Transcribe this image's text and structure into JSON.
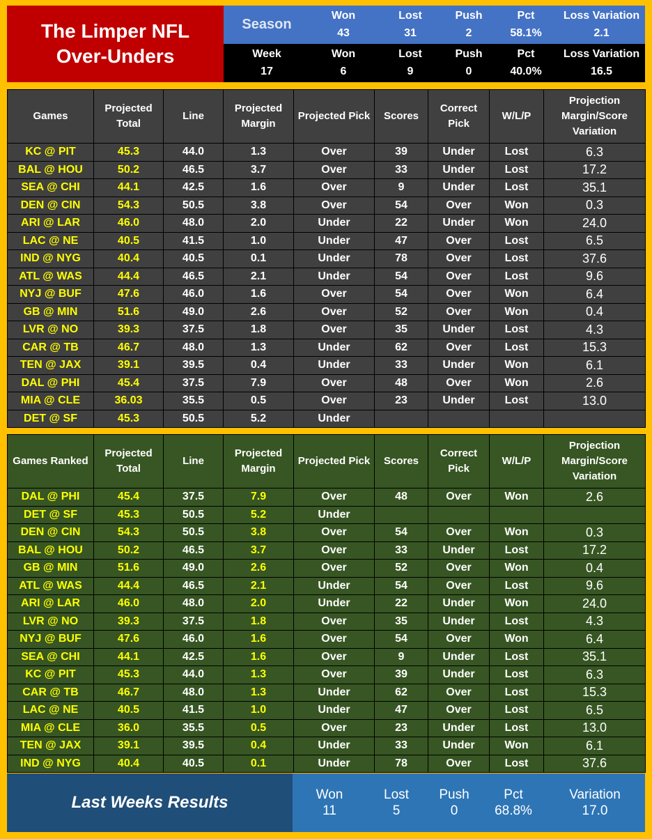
{
  "title": {
    "line1": "The Limper NFL",
    "line2": "Over-Unders"
  },
  "season": {
    "label": "Season",
    "cols": [
      {
        "h": "Won",
        "v": "43"
      },
      {
        "h": "Lost",
        "v": "31"
      },
      {
        "h": "Push",
        "v": "2"
      },
      {
        "h": "Pct",
        "v": "58.1%"
      },
      {
        "h": "Loss Variation",
        "v": "2.1"
      }
    ]
  },
  "week": {
    "cols": [
      {
        "h": "Week",
        "v": "17"
      },
      {
        "h": "Won",
        "v": "6"
      },
      {
        "h": "Lost",
        "v": "9"
      },
      {
        "h": "Push",
        "v": "0"
      },
      {
        "h": "Pct",
        "v": "40.0%"
      },
      {
        "h": "Loss Variation",
        "v": "16.5"
      }
    ]
  },
  "table1": {
    "headers": [
      "Games",
      "Projected Total",
      "Line",
      "Projected Margin",
      "Projected Pick",
      "Scores",
      "Correct Pick",
      "W/L/P",
      "Projection Margin/Score Variation"
    ],
    "rows": [
      [
        "KC @ PIT",
        "45.3",
        "44.0",
        "1.3",
        "Over",
        "39",
        "Under",
        "Lost",
        "6.3"
      ],
      [
        "BAL @ HOU",
        "50.2",
        "46.5",
        "3.7",
        "Over",
        "33",
        "Under",
        "Lost",
        "17.2"
      ],
      [
        "SEA @ CHI",
        "44.1",
        "42.5",
        "1.6",
        "Over",
        "9",
        "Under",
        "Lost",
        "35.1"
      ],
      [
        "DEN @ CIN",
        "54.3",
        "50.5",
        "3.8",
        "Over",
        "54",
        "Over",
        "Won",
        "0.3"
      ],
      [
        "ARI @ LAR",
        "46.0",
        "48.0",
        "2.0",
        "Under",
        "22",
        "Under",
        "Won",
        "24.0"
      ],
      [
        "LAC @ NE",
        "40.5",
        "41.5",
        "1.0",
        "Under",
        "47",
        "Over",
        "Lost",
        "6.5"
      ],
      [
        "IND @ NYG",
        "40.4",
        "40.5",
        "0.1",
        "Under",
        "78",
        "Over",
        "Lost",
        "37.6"
      ],
      [
        "ATL @ WAS",
        "44.4",
        "46.5",
        "2.1",
        "Under",
        "54",
        "Over",
        "Lost",
        "9.6"
      ],
      [
        "NYJ @ BUF",
        "47.6",
        "46.0",
        "1.6",
        "Over",
        "54",
        "Over",
        "Won",
        "6.4"
      ],
      [
        "GB @ MIN",
        "51.6",
        "49.0",
        "2.6",
        "Over",
        "52",
        "Over",
        "Won",
        "0.4"
      ],
      [
        "LVR @ NO",
        "39.3",
        "37.5",
        "1.8",
        "Over",
        "35",
        "Under",
        "Lost",
        "4.3"
      ],
      [
        "CAR @ TB",
        "46.7",
        "48.0",
        "1.3",
        "Under",
        "62",
        "Over",
        "Lost",
        "15.3"
      ],
      [
        "TEN @ JAX",
        "39.1",
        "39.5",
        "0.4",
        "Under",
        "33",
        "Under",
        "Won",
        "6.1"
      ],
      [
        "DAL @ PHI",
        "45.4",
        "37.5",
        "7.9",
        "Over",
        "48",
        "Over",
        "Won",
        "2.6"
      ],
      [
        "MIA @ CLE",
        "36.03",
        "35.5",
        "0.5",
        "Over",
        "23",
        "Under",
        "Lost",
        "13.0"
      ],
      [
        "DET @ SF",
        "45.3",
        "50.5",
        "5.2",
        "Under",
        "",
        "",
        "",
        ""
      ]
    ]
  },
  "table2": {
    "headers": [
      "Games Ranked",
      "Projected Total",
      "Line",
      "Projected Margin",
      "Projected Pick",
      "Scores",
      "Correct Pick",
      "W/L/P",
      "Projection Margin/Score Variation"
    ],
    "rows": [
      [
        "DAL @ PHI",
        "45.4",
        "37.5",
        "7.9",
        "Over",
        "48",
        "Over",
        "Won",
        "2.6"
      ],
      [
        "DET @ SF",
        "45.3",
        "50.5",
        "5.2",
        "Under",
        "",
        "",
        "",
        ""
      ],
      [
        "DEN @ CIN",
        "54.3",
        "50.5",
        "3.8",
        "Over",
        "54",
        "Over",
        "Won",
        "0.3"
      ],
      [
        "BAL @ HOU",
        "50.2",
        "46.5",
        "3.7",
        "Over",
        "33",
        "Under",
        "Lost",
        "17.2"
      ],
      [
        "GB @ MIN",
        "51.6",
        "49.0",
        "2.6",
        "Over",
        "52",
        "Over",
        "Won",
        "0.4"
      ],
      [
        "ATL @ WAS",
        "44.4",
        "46.5",
        "2.1",
        "Under",
        "54",
        "Over",
        "Lost",
        "9.6"
      ],
      [
        "ARI @ LAR",
        "46.0",
        "48.0",
        "2.0",
        "Under",
        "22",
        "Under",
        "Won",
        "24.0"
      ],
      [
        "LVR @ NO",
        "39.3",
        "37.5",
        "1.8",
        "Over",
        "35",
        "Under",
        "Lost",
        "4.3"
      ],
      [
        "NYJ @ BUF",
        "47.6",
        "46.0",
        "1.6",
        "Over",
        "54",
        "Over",
        "Won",
        "6.4"
      ],
      [
        "SEA @ CHI",
        "44.1",
        "42.5",
        "1.6",
        "Over",
        "9",
        "Under",
        "Lost",
        "35.1"
      ],
      [
        "KC @ PIT",
        "45.3",
        "44.0",
        "1.3",
        "Over",
        "39",
        "Under",
        "Lost",
        "6.3"
      ],
      [
        "CAR @ TB",
        "46.7",
        "48.0",
        "1.3",
        "Under",
        "62",
        "Over",
        "Lost",
        "15.3"
      ],
      [
        "LAC @ NE",
        "40.5",
        "41.5",
        "1.0",
        "Under",
        "47",
        "Over",
        "Lost",
        "6.5"
      ],
      [
        "MIA @ CLE",
        "36.0",
        "35.5",
        "0.5",
        "Over",
        "23",
        "Under",
        "Lost",
        "13.0"
      ],
      [
        "TEN @ JAX",
        "39.1",
        "39.5",
        "0.4",
        "Under",
        "33",
        "Under",
        "Won",
        "6.1"
      ],
      [
        "IND @ NYG",
        "40.4",
        "40.5",
        "0.1",
        "Under",
        "78",
        "Over",
        "Lost",
        "37.6"
      ]
    ]
  },
  "footer": {
    "label": "Last Weeks Results",
    "cols": [
      {
        "h": "Won",
        "v": "11"
      },
      {
        "h": "Lost",
        "v": "5"
      },
      {
        "h": "Push",
        "v": "0"
      },
      {
        "h": "Pct",
        "v": "68.8%"
      },
      {
        "h": "Variation",
        "v": "17.0"
      }
    ]
  },
  "colors": {
    "frame": "#ffc000",
    "title_bg": "#c00000",
    "season_bg": "#4472c4",
    "table1_bg": "#404040",
    "table2_bg": "#375623",
    "footer_label_bg": "#1f4e79",
    "footer_stats_bg": "#2e75b6",
    "highlight_text": "#ffff00"
  }
}
